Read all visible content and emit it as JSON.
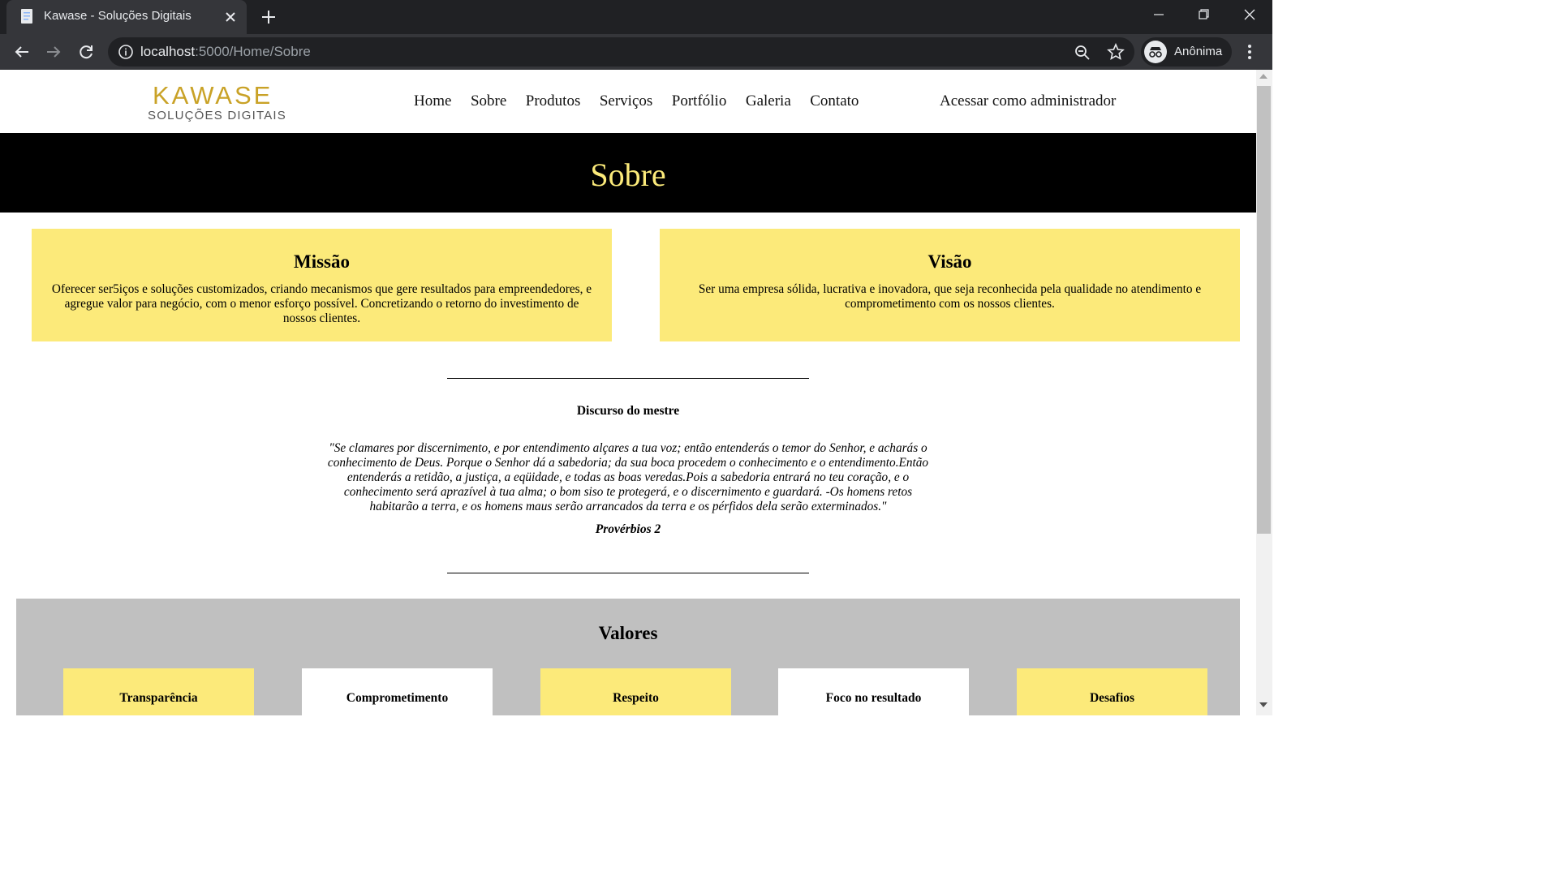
{
  "browser": {
    "tab_title": "Kawase - Soluções Digitais",
    "url_host": "localhost",
    "url_rest": ":5000/Home/Sobre",
    "profile_label": "Anônima"
  },
  "nav": {
    "logo_main": "KAWASE",
    "logo_sub": "SOLUÇÕES DIGITAIS",
    "links": [
      "Home",
      "Sobre",
      "Produtos",
      "Serviços",
      "Portfólio",
      "Galeria",
      "Contato"
    ],
    "admin": "Acessar como administrador"
  },
  "hero": {
    "title": "Sobre"
  },
  "missao": {
    "title": "Missão",
    "text": "Oferecer ser5iços e soluções customizados, criando mecanismos que gere resultados para empreendedores, e agregue valor para negócio, com o menor esforço possível. Concretizando o retorno do investimento de nossos clientes."
  },
  "visao": {
    "title": "Visão",
    "text": "Ser uma empresa sólida, lucrativa e inovadora, que seja reconhecida pela qualidade no atendimento e comprometimento com os nossos clientes."
  },
  "speech": {
    "title": "Discurso do mestre",
    "quote": "\"Se clamares por discernimento, e por entendimento alçares a tua voz; então entenderás o temor do Senhor, e acharás o conhecimento de Deus. Porque o Senhor dá a sabedoria; da sua boca procedem o conhecimento e o entendimento.Então entenderás a retidão, a justiça, a eqüidade, e todas as boas veredas.Pois a sabedoria entrará no teu coração, e o conhecimento será aprazível à tua alma; o bom siso te protegerá, e o discernimento e guardará. -Os homens retos habitarão a terra, e os homens maus serão arrancados da terra e os pérfidos dela serão exterminados.\"",
    "reference": "Provérbios 2"
  },
  "values": {
    "title": "Valores",
    "items": [
      "Transparência",
      "Comprometimento",
      "Respeito",
      "Foco no resultado",
      "Desafios"
    ]
  },
  "colors": {
    "accent_yellow": "#fcea7a",
    "hero_bg": "#000000",
    "values_bg": "#c0c0c0",
    "logo_gold": "#c9a227"
  }
}
